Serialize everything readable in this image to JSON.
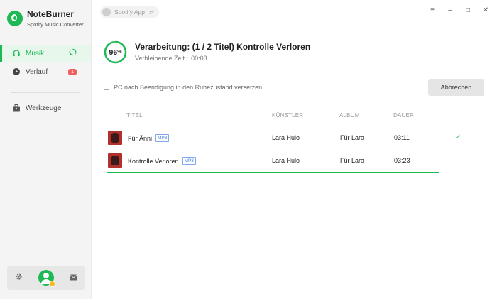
{
  "brand": {
    "name": "NoteBurner",
    "subtitle": "Spotify Music Converter"
  },
  "sidebar": {
    "items": [
      {
        "label": "Musik",
        "icon": "headphones-icon",
        "active": true,
        "right_icon": "sync-icon"
      },
      {
        "label": "Verlauf",
        "icon": "clock-icon",
        "badge": "1"
      },
      {
        "label": "Werkzeuge",
        "icon": "toolbox-icon"
      }
    ],
    "bottom": {
      "settings_icon": "gear-icon",
      "avatar_icon": "user-avatar-icon",
      "mail_icon": "mail-icon"
    }
  },
  "topbar": {
    "app_label": "Spotify App",
    "swap_icon": "swap-icon"
  },
  "window_controls": [
    "menu-icon",
    "minimize-icon",
    "maximize-icon",
    "close-icon"
  ],
  "processing": {
    "percent": 96,
    "percent_number": "96",
    "percent_sign": "%",
    "title": "Verarbeitung: (1 / 2 Titel) Kontrolle Verloren",
    "remaining_label": "Verbleibende Zeit :",
    "remaining_value": "00:03"
  },
  "options": {
    "sleep_label": "PC nach Beendigung in den Ruhezustand versetzen",
    "sleep_checked": false
  },
  "cancel_label": "Abbrechen",
  "table": {
    "headers": {
      "title": "TITEL",
      "artist": "KÜNSTLER",
      "album": "ALBUM",
      "duration": "DAUER"
    },
    "rows": [
      {
        "title": "Für Änni",
        "format": "MP3",
        "artist": "Lara Hulo",
        "album": "Für Lara",
        "duration": "03:11",
        "status": "done",
        "progress": 1.0
      },
      {
        "title": "Kontrolle Verloren",
        "format": "MP3",
        "artist": "Lara Hulo",
        "album": "Für Lara",
        "duration": "03:23",
        "status": "converting",
        "progress": 0.96
      }
    ]
  },
  "colors": {
    "accent": "#1db954",
    "badge": "#f25d5d",
    "mp3_tag": "#3a7be0"
  }
}
